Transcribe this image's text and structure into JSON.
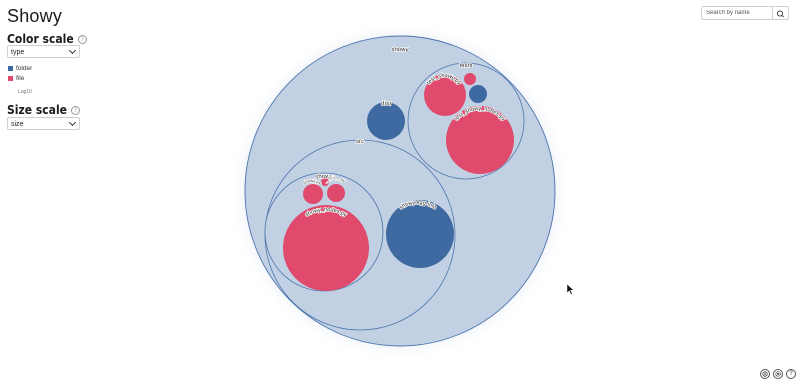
{
  "app": {
    "title": "Showy"
  },
  "color_scale": {
    "title": "Color scale",
    "selected": "type",
    "legend": [
      {
        "label": "folder",
        "color": "#3e6aa1"
      },
      {
        "label": "file",
        "color": "#e04a6c"
      }
    ],
    "note": "Log10"
  },
  "size_scale": {
    "title": "Size scale",
    "selected": "size"
  },
  "search": {
    "placeholder": "Search by name"
  },
  "colors": {
    "folder": "#3e6aa1",
    "file": "#e04a6c",
    "container_fill": "#c2d0e3",
    "container_stroke": "#4d76ad"
  },
  "circles": {
    "root": "showy",
    "tests": "tests",
    "dist": "dist",
    "src": "src",
    "showy_inner": "showy",
    "src_folder": "showy.egg-info",
    "tests_file_a": "test_showy.py",
    "tests_file_b": "test_showy_nodes.py",
    "src_file_big": "showy_nodes.py",
    "src_file_a": "showy.py",
    "src_file_b": "__init__.py"
  },
  "icons": [
    "target-icon",
    "settings-icon",
    "help-icon"
  ]
}
